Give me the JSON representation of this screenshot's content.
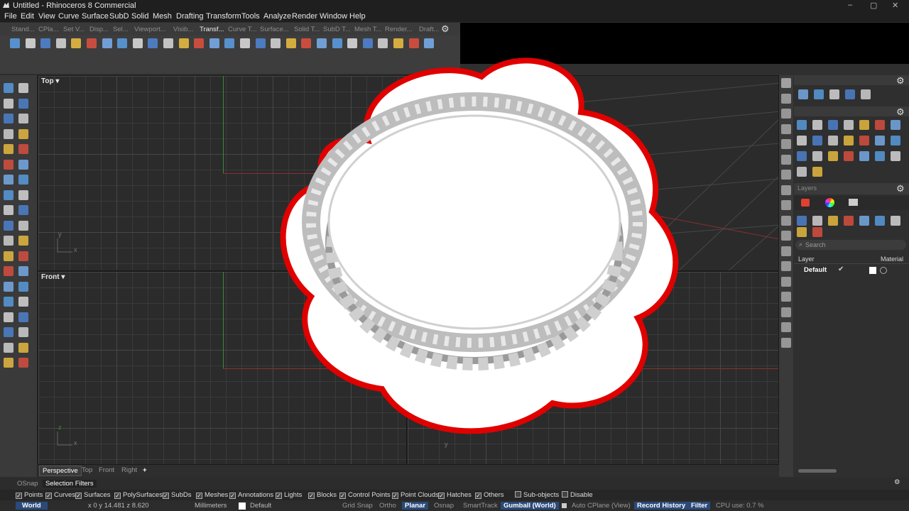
{
  "window": {
    "title": "Untitled - Rhinoceros 8 Commercial",
    "controls": [
      "–",
      "▢",
      "✕"
    ]
  },
  "menubar": [
    "File",
    "Edit",
    "View",
    "Curve",
    "Surface",
    "SubD",
    "Solid",
    "Mesh",
    "Drafting",
    "Transform",
    "Tools",
    "Analyze",
    "Render",
    "Window",
    "Help"
  ],
  "toolbar_tabs": [
    "Stand...",
    "CPla...",
    "Set V...",
    "Disp...",
    "Sel...",
    "Viewport...",
    "Visib...",
    "Transf...",
    "Curve T...",
    "Surface...",
    "Solid T...",
    "SubD T...",
    "Mesh T...",
    "Render...",
    "Draft..."
  ],
  "active_toolbar_tab": "Transf...",
  "viewports": {
    "top": {
      "label": "Top",
      "axis_x": "x",
      "axis_y": "y"
    },
    "front": {
      "label": "Front",
      "axis_x": "x",
      "axis_z": "z"
    },
    "perspective": {
      "axis_y": "y"
    }
  },
  "viewport_tabs": [
    "Perspective",
    "Top",
    "Front",
    "Right"
  ],
  "viewport_tab_add": "+",
  "right_panel": {
    "layers_title": "Layers",
    "search_placeholder": "Search",
    "col_layer": "Layer",
    "col_material": "Material",
    "layer_name": "Default",
    "layer_check": "✔"
  },
  "osnap_tabs": [
    "OSnap",
    "Selection Filters"
  ],
  "filters": [
    {
      "label": "Points",
      "checked": true
    },
    {
      "label": "Curves",
      "checked": true
    },
    {
      "label": "Surfaces",
      "checked": true
    },
    {
      "label": "PolySurfaces",
      "checked": true
    },
    {
      "label": "SubDs",
      "checked": true
    },
    {
      "label": "Meshes",
      "checked": true
    },
    {
      "label": "Annotations",
      "checked": true
    },
    {
      "label": "Lights",
      "checked": true
    },
    {
      "label": "Blocks",
      "checked": true
    },
    {
      "label": "Control Points",
      "checked": true
    },
    {
      "label": "Point Clouds",
      "checked": true
    },
    {
      "label": "Hatches",
      "checked": true
    },
    {
      "label": "Others",
      "checked": true
    },
    {
      "label": "Sub-objects",
      "checked": false
    },
    {
      "label": "Disable",
      "checked": false
    }
  ],
  "status": {
    "world": "World",
    "coords": "x 0   y 14.481   z 8.620",
    "units": "Millimeters",
    "layer": "Default",
    "grid_snap": "Grid Snap",
    "ortho": "Ortho",
    "planar": "Planar",
    "osnap": "Osnap",
    "smarttrack": "SmartTrack",
    "gumball": "Gumball (World)",
    "auto_cplane": "Auto CPlane (View)",
    "record_history": "Record History",
    "filter": "Filter",
    "cpu": "CPU use: 0.7 %"
  },
  "colors": {
    "accent_blue": "#2a4a7a",
    "overlay_border": "#e00000",
    "axis_green": "#3a8a3a",
    "axis_red": "#8a3030"
  }
}
